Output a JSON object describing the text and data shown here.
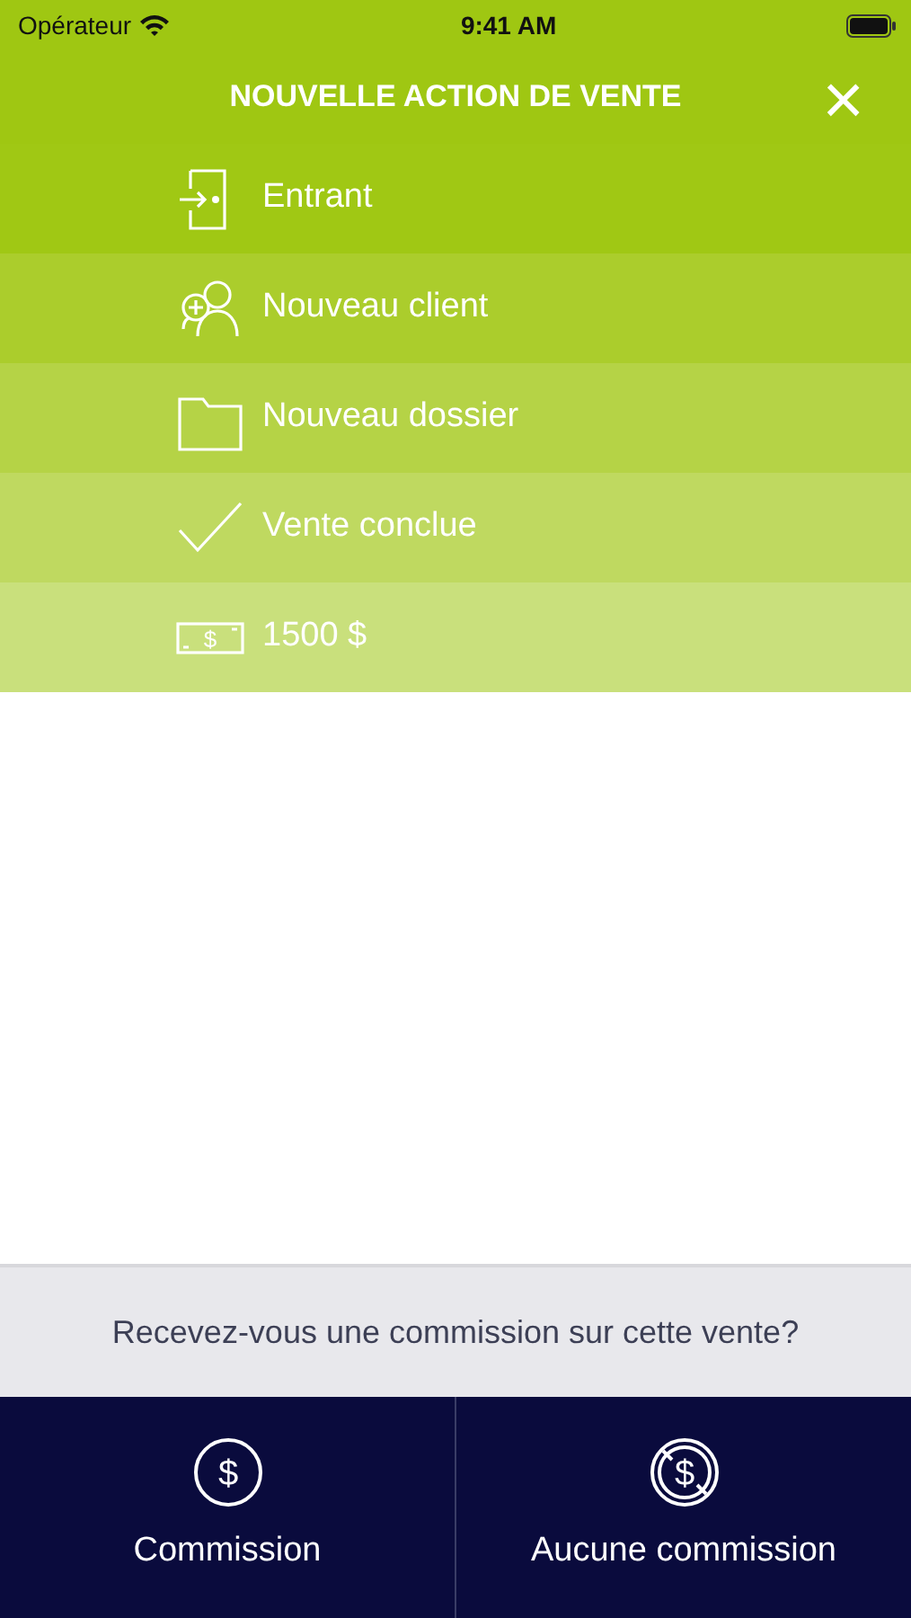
{
  "status_bar": {
    "carrier": "Opérateur",
    "time": "9:41 AM"
  },
  "header": {
    "title": "NOUVELLE ACTION DE VENTE",
    "close": "×"
  },
  "steps": [
    {
      "kind": "door",
      "label": "Entrant",
      "color": "#a0c814"
    },
    {
      "kind": "person-add",
      "label": "Nouveau client",
      "color": "#abcd2c"
    },
    {
      "kind": "folder",
      "label": "Nouveau dossier",
      "color": "#b5d346"
    },
    {
      "kind": "check",
      "label": "Vente conclue",
      "color": "#bfd960"
    },
    {
      "kind": "money",
      "label": "1500 $",
      "icon_glyph": "$",
      "color": "#c9e07c"
    }
  ],
  "prompt": "Recevez-vous une commission sur cette vente?",
  "buttons": [
    {
      "kind": "dollar",
      "label": "Commission",
      "icon_glyph": "$"
    },
    {
      "kind": "no-dollar",
      "label": "Aucune commission",
      "icon_glyph": "$"
    }
  ]
}
